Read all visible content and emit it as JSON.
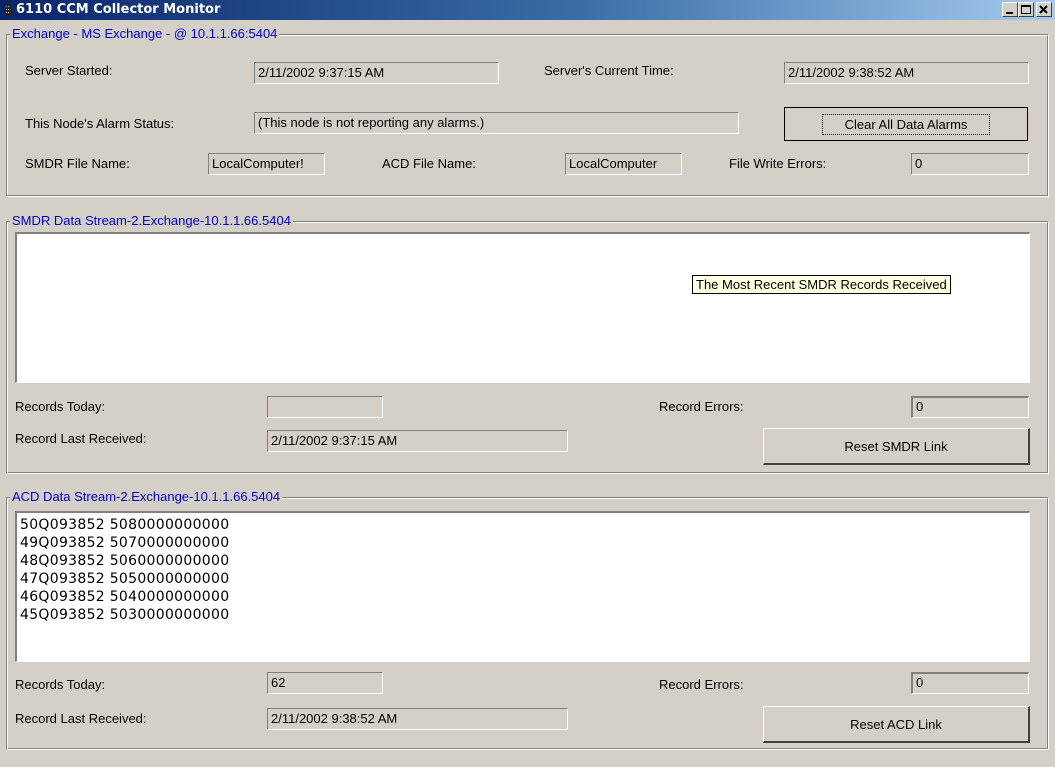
{
  "window": {
    "title": "6110 CCM Collector Monitor"
  },
  "exchange": {
    "legend": "Exchange - MS Exchange - @ 10.1.1.66:5404",
    "server_started_label": "Server Started:",
    "server_started_value": "2/11/2002 9:37:15 AM",
    "current_time_label": "Server's Current Time:",
    "current_time_value": "2/11/2002 9:38:52 AM",
    "alarm_status_label": "This Node's Alarm Status:",
    "alarm_status_value": "(This node is not reporting any alarms.)",
    "clear_alarms_button": "Clear All Data Alarms",
    "smdr_file_label": "SMDR File Name:",
    "smdr_file_value": "LocalComputer!",
    "acd_file_label": "ACD File Name:",
    "acd_file_value": "LocalComputer",
    "file_write_errors_label": "File Write Errors:",
    "file_write_errors_value": "0"
  },
  "smdr": {
    "legend": "SMDR Data Stream-2.Exchange-10.1.1.66.5404",
    "tooltip": "The Most Recent SMDR Records Received",
    "records_today_label": "Records Today:",
    "records_today_value": "",
    "record_errors_label": "Record Errors:",
    "record_errors_value": "0",
    "last_received_label": "Record Last Received:",
    "last_received_value": "2/11/2002 9:37:15 AM",
    "reset_button": "Reset SMDR Link"
  },
  "acd": {
    "legend": "ACD Data Stream-2.Exchange-10.1.1.66.5404",
    "records": [
      "50Q093852 5080000000000",
      "49Q093852 5070000000000",
      "48Q093852 5060000000000",
      "47Q093852 5050000000000",
      "46Q093852 5040000000000",
      "45Q093852 5030000000000"
    ],
    "records_today_label": "Records Today:",
    "records_today_value": "62",
    "record_errors_label": "Record Errors:",
    "record_errors_value": "0",
    "last_received_label": "Record Last Received:",
    "last_received_value": "2/11/2002 9:38:52 AM",
    "reset_button": "Reset ACD Link"
  },
  "icons": {
    "title_icon": "phone-handset-icon",
    "minimize": "minimize-icon",
    "maximize": "maximize-icon",
    "close": "close-icon"
  }
}
